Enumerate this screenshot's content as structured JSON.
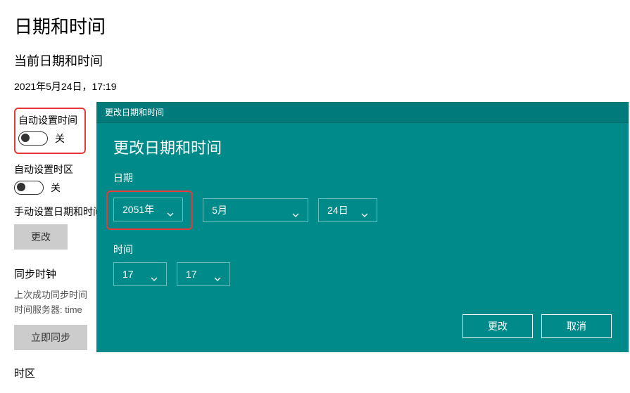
{
  "page": {
    "title": "日期和时间",
    "current_heading": "当前日期和时间",
    "current_datetime": "2021年5月24日，17:19"
  },
  "toggles": {
    "auto_time": {
      "label": "自动设置时间",
      "state": "关"
    },
    "auto_tz": {
      "label": "自动设置时区",
      "state": "关"
    }
  },
  "manual": {
    "label": "手动设置日期和时间",
    "change_btn": "更改"
  },
  "sync": {
    "heading": "同步时钟",
    "last_success": "上次成功同步时间",
    "server": "时间服务器: time",
    "sync_now_btn": "立即同步"
  },
  "tz": {
    "heading": "时区"
  },
  "dialog": {
    "titlebar": "更改日期和时间",
    "heading": "更改日期和时间",
    "date_label": "日期",
    "year": "2051年",
    "month": "5月",
    "day": "24日",
    "time_label": "时间",
    "hour": "17",
    "minute": "17",
    "change_btn": "更改",
    "cancel_btn": "取消"
  }
}
